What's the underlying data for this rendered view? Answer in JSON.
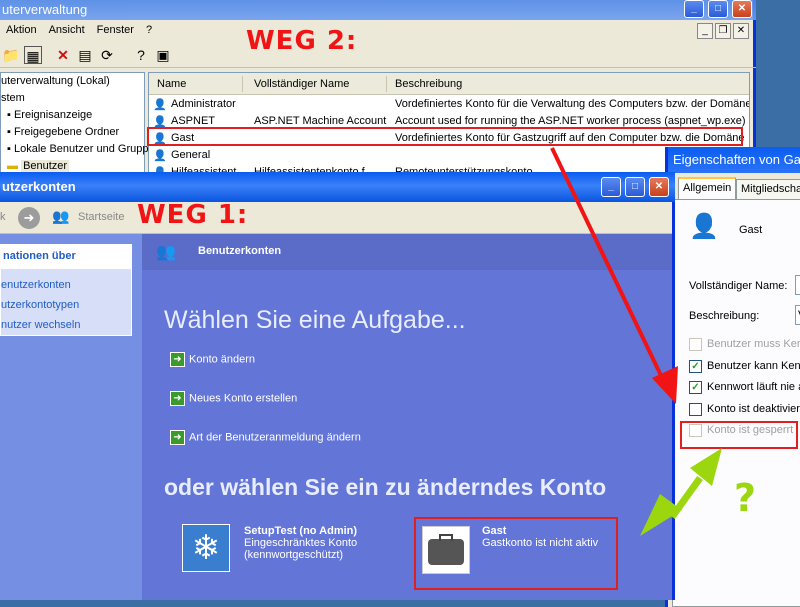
{
  "cv": {
    "title": "uterverwaltung",
    "menu": [
      "Aktion",
      "Ansicht",
      "Fenster",
      "?"
    ],
    "tree": [
      "uterverwaltung (Lokal)",
      "stem",
      "Ereignisanzeige",
      "Freigegebene Ordner",
      "Lokale Benutzer und Gruppe",
      "Benutzer"
    ],
    "columns": [
      "Name",
      "Vollständiger Name",
      "Beschreibung"
    ],
    "rows": [
      {
        "name": "Administrator",
        "full": "",
        "desc": "Vordefiniertes Konto für die Verwaltung des Computers bzw. der Domäne"
      },
      {
        "name": "ASPNET",
        "full": "ASP.NET Machine Account",
        "desc": "Account used for running the ASP.NET worker process (aspnet_wp.exe)"
      },
      {
        "name": "Gast",
        "full": "",
        "desc": "Vordefiniertes Konto für Gastzugriff auf den Computer bzw. die Domäne"
      },
      {
        "name": "General",
        "full": "",
        "desc": ""
      },
      {
        "name": "Hilfeassistent",
        "full": "Hilfeassistentenkonto f...",
        "desc": "Remoteunterstützungskonto"
      }
    ]
  },
  "annotations": {
    "weg2": "WEG 2:",
    "weg1": "WEG 1:",
    "question": "?"
  },
  "eg": {
    "title": "Eigenschaften von Gast",
    "tabs": [
      "Allgemein",
      "Mitgliedschaft"
    ],
    "user": "Gast",
    "full_name_label": "Vollständiger Name:",
    "desc_label": "Beschreibung:",
    "desc_value": "V",
    "checks": [
      {
        "label": "Benutzer muss Kenn",
        "checked": false,
        "disabled": true
      },
      {
        "label": "Benutzer kann Kenn",
        "checked": true,
        "disabled": false
      },
      {
        "label": "Kennwort läuft nie ab",
        "checked": true,
        "disabled": false
      },
      {
        "label": "Konto ist deaktiviert",
        "checked": false,
        "disabled": false
      },
      {
        "label": "Konto ist gesperrt",
        "checked": false,
        "disabled": true
      }
    ]
  },
  "bk": {
    "title": "utzerkonten",
    "toolbar": {
      "back": "k",
      "home": "Startseite"
    },
    "left_head": "nationen über",
    "left_links": [
      "enutzerkonten",
      "utzerkontotypen",
      "nutzer wechseln"
    ],
    "header": "Benutzerkonten",
    "heading1": "Wählen Sie eine Aufgabe...",
    "tasks": [
      "Konto ändern",
      "Neues Konto erstellen",
      "Art der Benutzeranmeldung ändern"
    ],
    "heading2": "oder wählen Sie ein zu änderndes Konto",
    "accounts": [
      {
        "name": "SetupTest (no Admin)",
        "line1": "Eingeschränktes Konto",
        "line2": "(kennwortgeschützt)"
      },
      {
        "name": "Gast",
        "line1": "Gastkonto ist nicht aktiv",
        "line2": ""
      }
    ]
  },
  "colors": {
    "xp_blue": "#0a5df0",
    "annotation_red": "#f01414",
    "annotation_green": "#9bd60f",
    "panel_blue": "#6375d6"
  }
}
